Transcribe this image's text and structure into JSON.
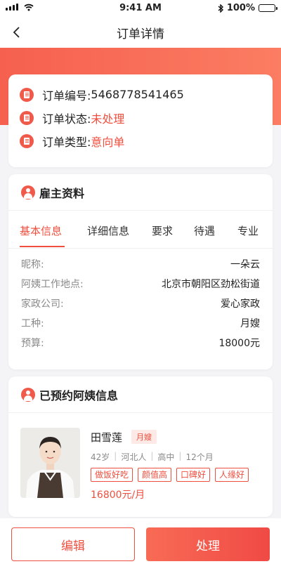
{
  "status_bar": {
    "time": "9:41 AM",
    "battery_text": "100%"
  },
  "nav": {
    "title": "订单详情"
  },
  "order": {
    "number_label": "订单编号: ",
    "number_value": "5468778541465",
    "status_label": "订单状态: ",
    "status_value": "未处理",
    "type_label": "订单类型: ",
    "type_value": "意向单"
  },
  "employer": {
    "title": "雇主资料",
    "tabs": [
      "基本信息",
      "详细信息",
      "要求",
      "待遇",
      "专业"
    ],
    "active_tab": 0,
    "rows": [
      {
        "key": "昵称:",
        "value": "一朵云"
      },
      {
        "key": "阿姨工作地点:",
        "value": "北京市朝阳区劲松街道"
      },
      {
        "key": "家政公司:",
        "value": "爱心家政"
      },
      {
        "key": "工种:",
        "value": "月嫂"
      },
      {
        "key": "预算:",
        "value": "18000元"
      }
    ]
  },
  "nanny": {
    "title": "已预约阿姨信息",
    "name": "田雪莲",
    "tag": "月嫂",
    "meta": [
      "42岁",
      "河北人",
      "高中",
      "12个月"
    ],
    "skills": [
      "做饭好吃",
      "颜值高",
      "口碑好",
      "人缘好"
    ],
    "price": "16800元/月"
  },
  "actions": {
    "edit_label": "编辑",
    "process_label": "处理"
  },
  "colors": {
    "accent": "#ef4f3f",
    "hero_start": "#f6604f",
    "hero_end": "#fb7d62"
  }
}
